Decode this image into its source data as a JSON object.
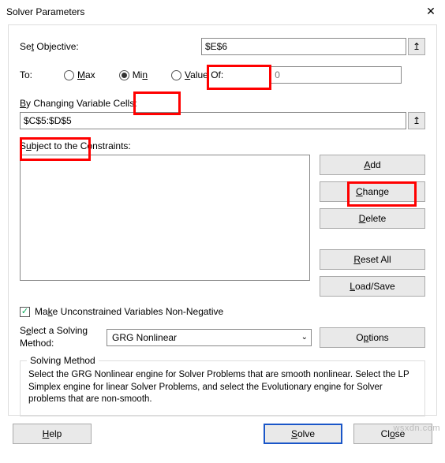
{
  "window": {
    "title": "Solver Parameters",
    "close_glyph": "✕"
  },
  "objective": {
    "label_pre": "Se",
    "label_u": "t",
    "label_post": " Objective:",
    "value": "$E$6",
    "ref_glyph": "↥"
  },
  "to": {
    "label": "To:",
    "max_u": "M",
    "max_post": "ax",
    "min_pre": "Mi",
    "min_u": "n",
    "valueof_u": "V",
    "valueof_post": "alue Of:",
    "valueof_value": "0"
  },
  "variables": {
    "label_u": "B",
    "label_post": "y Changing Variable Cells:",
    "value": "$C$5:$D$5",
    "ref_glyph": "↥"
  },
  "constraints": {
    "label_pre": "S",
    "label_u": "u",
    "label_post": "bject to the Constraints:"
  },
  "side": {
    "add_u": "A",
    "add_post": "dd",
    "change_u": "C",
    "change_post": "hange",
    "delete_u": "D",
    "delete_post": "elete",
    "reset_u": "R",
    "reset_post": "eset All",
    "load_u": "L",
    "load_post": "oad/Save"
  },
  "unconstrained": {
    "checked_glyph": "✓",
    "label_pre": "Ma",
    "label_u": "k",
    "label_post": "e Unconstrained Variables Non-Negative"
  },
  "method": {
    "label_pre": "S",
    "label_u": "e",
    "label_post": "lect a Solving Method:",
    "value": "GRG Nonlinear",
    "chev": "⌄",
    "options_pre": "O",
    "options_u": "p",
    "options_post": "tions"
  },
  "help_group": {
    "legend": "Solving Method",
    "text": "Select the GRG Nonlinear engine for Solver Problems that are smooth nonlinear. Select the LP Simplex engine for linear Solver Problems, and select the Evolutionary engine for Solver problems that are non-smooth."
  },
  "footer": {
    "help_u": "H",
    "help_post": "elp",
    "solve_u": "S",
    "solve_post": "olve",
    "close_pre": "Cl",
    "close_u": "o",
    "close_post": "se"
  },
  "watermark": "wsxdn.com"
}
